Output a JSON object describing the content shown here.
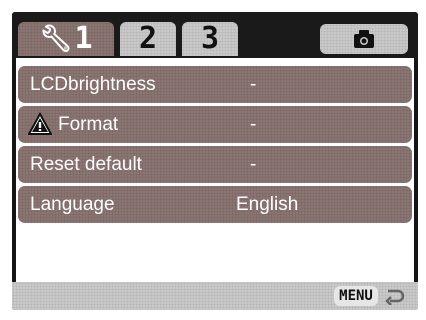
{
  "tabs": {
    "tab1_label": "1",
    "tab1_icon": "wrench-icon",
    "tab2_label": "2",
    "tab3_label": "3",
    "camera_icon": "camera-icon"
  },
  "menu": {
    "items": [
      {
        "label": "LCDbrightness",
        "value": "-"
      },
      {
        "label": "Format",
        "value": "-",
        "icon": "warning-icon"
      },
      {
        "label": "Reset default",
        "value": "-"
      },
      {
        "label": "Language",
        "value": "English"
      }
    ]
  },
  "footer": {
    "menu_label": "MENU",
    "return_icon": "return-arrow-icon"
  },
  "colors": {
    "selected_row": "#8a7572",
    "tab_inactive": "#c9c9c9",
    "panel": "#ffffff",
    "frame": "#151515"
  }
}
